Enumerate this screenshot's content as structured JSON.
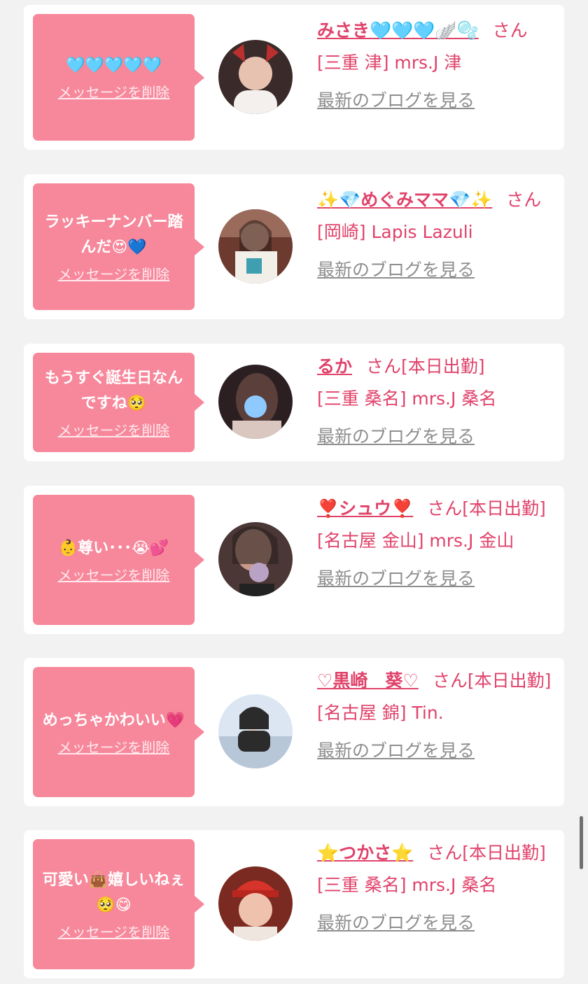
{
  "cards": [
    {
      "message": "🩵🩵🩵🩵🩵",
      "delete_label": "メッセージを削除",
      "name": "みさき🩵🩵🩵🪽🫧",
      "honorific": "さん",
      "status": "",
      "shop": "[三重 津] mrs.J 津",
      "blog_label": "最新のブログを見る",
      "avatar_colors": [
        "#3a2b2a",
        "#c08b7d"
      ]
    },
    {
      "message": "ラッキーナンバー踏んだ😍💙",
      "delete_label": "メッセージを削除",
      "name": "✨💎めぐみママ💎✨",
      "honorific": "さん",
      "status": "",
      "shop": "[岡崎] Lapis Lazuli",
      "blog_label": "最新のブログを見る",
      "avatar_colors": [
        "#6c3a2f",
        "#3d9fb0"
      ]
    },
    {
      "message": "もうすぐ誕生日なんですね🥺",
      "delete_label": "メッセージを削除",
      "name": "るか",
      "honorific": "さん",
      "status": "[本日出勤]",
      "shop": "[三重 桑名] mrs.J 桑名",
      "blog_label": "最新のブログを見る",
      "avatar_colors": [
        "#2c1f22",
        "#8ec9ff"
      ]
    },
    {
      "message": "👶尊い･･･😭💕",
      "delete_label": "メッセージを削除",
      "name": "❣️シュウ❣️",
      "honorific": "さん",
      "status": "[本日出勤]",
      "shop": "[名古屋 金山] mrs.J 金山",
      "blog_label": "最新のブログを見る",
      "avatar_colors": [
        "#4a3736",
        "#b9a3c4"
      ]
    },
    {
      "message": "めっちゃかわいい💗",
      "delete_label": "メッセージを削除",
      "name": "♡黒崎　葵♡",
      "honorific": "さん",
      "status": "[本日出勤]",
      "shop": "[名古屋 錦] Tin.",
      "blog_label": "最新のブログを見る",
      "avatar_colors": [
        "#dbe6f2",
        "#2b2b2b"
      ]
    },
    {
      "message": "可愛い👜嬉しいねぇ🥺😋",
      "delete_label": "メッセージを削除",
      "name": "⭐️つかさ⭐️",
      "honorific": "さん",
      "status": "[本日出勤]",
      "shop": "[三重 桑名] mrs.J 桑名",
      "blog_label": "最新のブログを見る",
      "avatar_colors": [
        "#7a2a20",
        "#d6332b"
      ]
    }
  ]
}
